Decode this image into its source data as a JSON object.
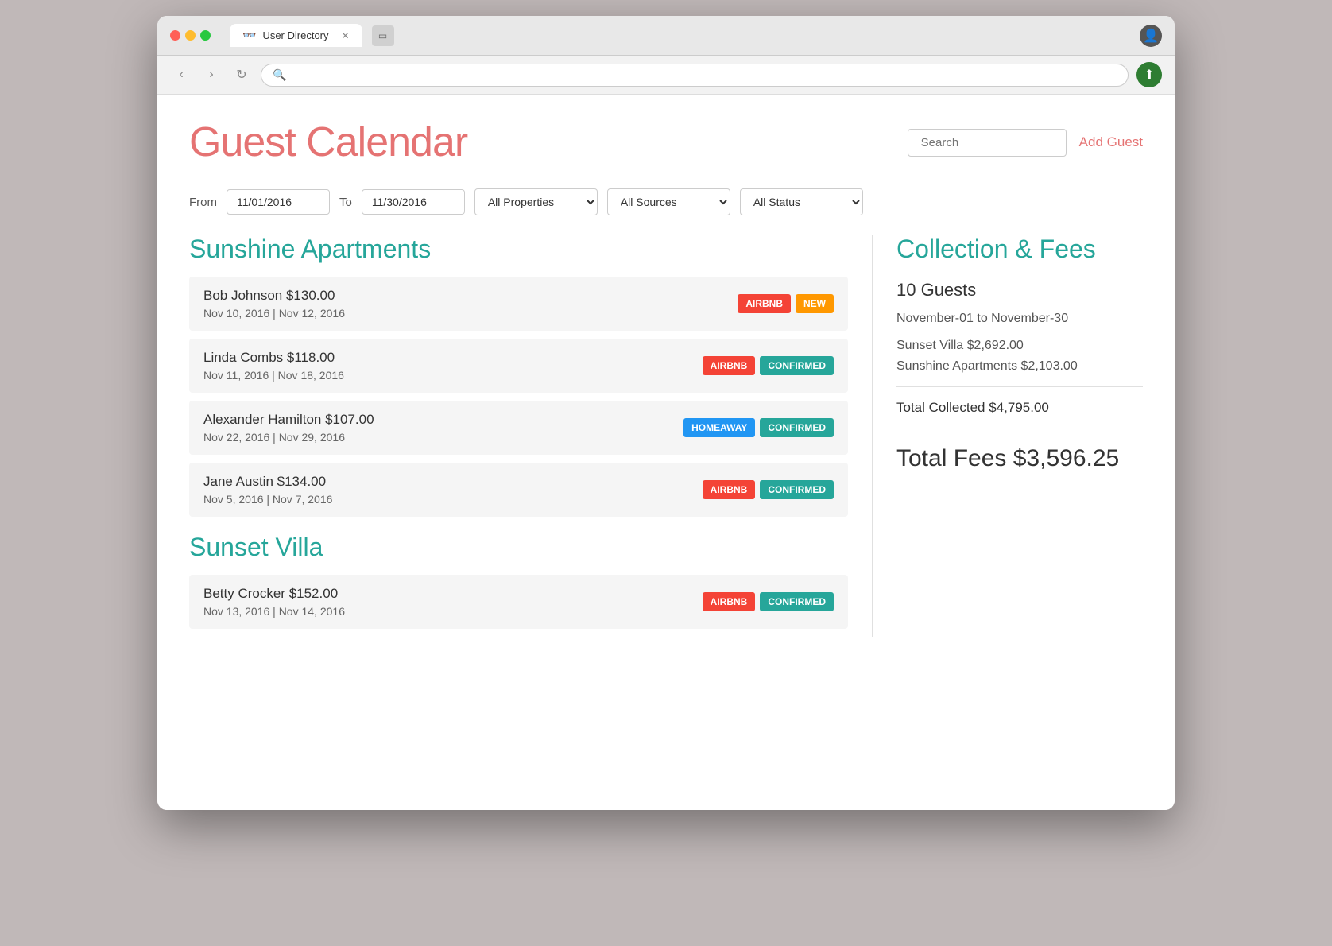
{
  "browser": {
    "dots": [
      "red",
      "yellow",
      "green"
    ],
    "tab": {
      "icon": "👓",
      "title": "User Directory",
      "close": "✕"
    },
    "new_tab_icon": "▭",
    "nav": {
      "back": "‹",
      "forward": "›",
      "refresh": "↻",
      "search_icon": "🔍"
    },
    "user_icon": "👤",
    "upload_icon": "⬆"
  },
  "app": {
    "title": "Guest Calendar",
    "search_placeholder": "Search",
    "add_guest_label": "Add Guest"
  },
  "filters": {
    "from_label": "From",
    "from_date": "11/01/2016",
    "to_label": "To",
    "to_date": "11/30/2016",
    "all_properties": "All Properties",
    "all_sources": "All Sources",
    "all_status": "All Status"
  },
  "properties": [
    {
      "name": "Sunshine Apartments",
      "guests": [
        {
          "name": "Bob Johnson",
          "amount": "$130.00",
          "date_range": "Nov 10, 2016 | Nov 12, 2016",
          "source": "AIRBNB",
          "source_type": "airbnb",
          "status": "NEW",
          "status_type": "new"
        },
        {
          "name": "Linda Combs",
          "amount": "$118.00",
          "date_range": "Nov 11, 2016 | Nov 18, 2016",
          "source": "AIRBNB",
          "source_type": "airbnb",
          "status": "CONFIRMED",
          "status_type": "confirmed"
        },
        {
          "name": "Alexander Hamilton",
          "amount": "$107.00",
          "date_range": "Nov 22, 2016 | Nov 29, 2016",
          "source": "HOMEAWAY",
          "source_type": "homeaway",
          "status": "CONFIRMED",
          "status_type": "confirmed"
        },
        {
          "name": "Jane Austin",
          "amount": "$134.00",
          "date_range": "Nov 5, 2016 | Nov 7, 2016",
          "source": "AIRBNB",
          "source_type": "airbnb",
          "status": "CONFIRMED",
          "status_type": "confirmed"
        }
      ]
    },
    {
      "name": "Sunset Villa",
      "guests": [
        {
          "name": "Betty Crocker",
          "amount": "$152.00",
          "date_range": "Nov 13, 2016 | Nov 14, 2016",
          "source": "AIRBNB",
          "source_type": "airbnb",
          "status": "CONFIRMED",
          "status_type": "confirmed"
        }
      ]
    }
  ],
  "collection": {
    "title": "Collection & Fees",
    "guests_count": "10 Guests",
    "date_range": "November-01 to November-30",
    "sunset_villa": "Sunset Villa $2,692.00",
    "sunshine_apartments": "Sunshine Apartments $2,103.00",
    "total_collected_label": "Total Collected",
    "total_collected": "$4,795.00",
    "total_fees_label": "Total Fees",
    "total_fees": "$3,596.25"
  }
}
